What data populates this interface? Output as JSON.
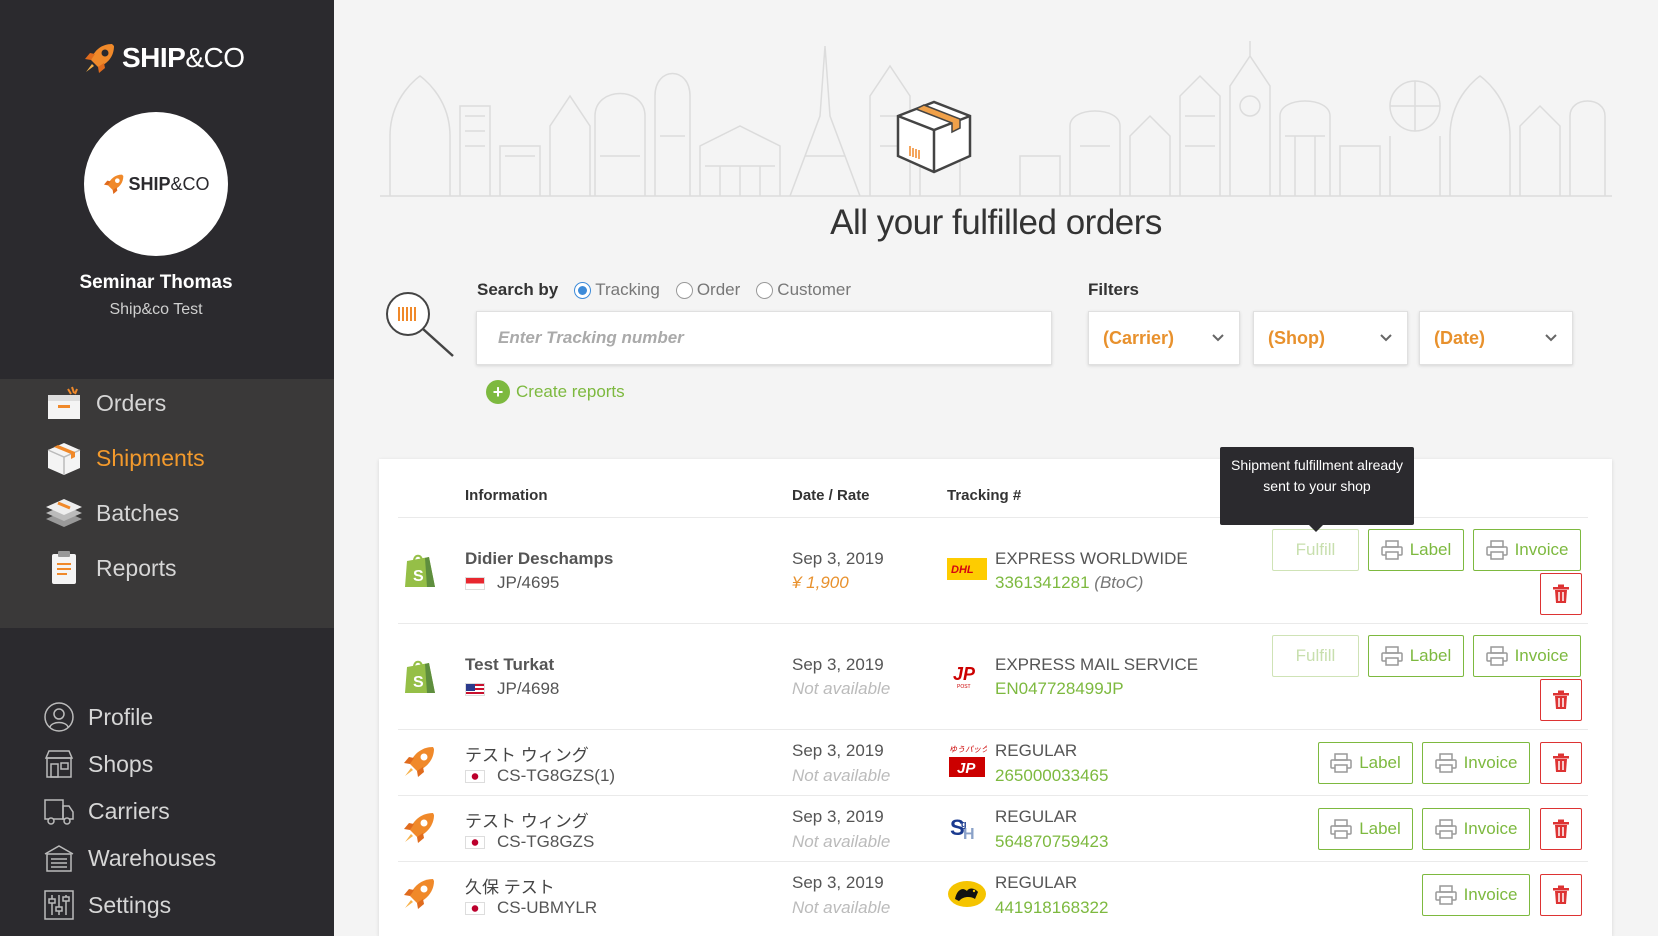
{
  "brand": {
    "name_bold": "SHIP",
    "name_light": "&CO"
  },
  "user": {
    "name": "Seminar Thomas",
    "org": "Ship&co Test"
  },
  "nav_main": [
    {
      "label": "Orders",
      "icon": "orders-box-icon",
      "active": false
    },
    {
      "label": "Shipments",
      "icon": "shipment-box-icon",
      "active": true
    },
    {
      "label": "Batches",
      "icon": "batches-stack-icon",
      "active": false
    },
    {
      "label": "Reports",
      "icon": "clipboard-icon",
      "active": false
    }
  ],
  "nav_sub": [
    {
      "label": "Profile",
      "icon": "user-icon"
    },
    {
      "label": "Shops",
      "icon": "shop-icon"
    },
    {
      "label": "Carriers",
      "icon": "truck-icon"
    },
    {
      "label": "Warehouses",
      "icon": "warehouse-icon"
    },
    {
      "label": "Settings",
      "icon": "sliders-icon"
    }
  ],
  "hero": {
    "title": "All your fulfilled orders"
  },
  "search": {
    "label": "Search by",
    "options": [
      "Tracking",
      "Order",
      "Customer"
    ],
    "selected": "Tracking",
    "placeholder": "Enter Tracking number",
    "value": ""
  },
  "create_reports": "Create reports",
  "filters": {
    "label": "Filters",
    "items": [
      "(Carrier)",
      "(Shop)",
      "(Date)"
    ]
  },
  "table": {
    "headers": [
      "Information",
      "Date / Rate",
      "Tracking #"
    ],
    "tooltip": "Shipment fulfillment already sent to your shop",
    "buttons": {
      "fulfill": "Fulfill",
      "label": "Label",
      "invoice": "Invoice"
    },
    "rows": [
      {
        "source": "shopify",
        "name": "Didier Deschamps",
        "flag": "SG",
        "order": "JP/4695",
        "date": "Sep 3, 2019",
        "rate": "¥ 1,900",
        "rate_available": true,
        "carrier": "DHL",
        "service": "EXPRESS WORLDWIDE",
        "tracking": "3361341281",
        "tracking_extra": "(BtoC)",
        "actions": [
          "fulfill",
          "label",
          "invoice",
          "delete"
        ]
      },
      {
        "source": "shopify",
        "name": "Test Turkat",
        "flag": "US",
        "order": "JP/4698",
        "date": "Sep 3, 2019",
        "rate": "Not available",
        "rate_available": false,
        "carrier": "JP Post",
        "service": "EXPRESS MAIL SERVICE",
        "tracking": "EN047728499JP",
        "tracking_extra": "",
        "actions": [
          "fulfill",
          "label",
          "invoice",
          "delete"
        ]
      },
      {
        "source": "shipandco",
        "name": "テスト ウィング",
        "flag": "JP",
        "order": "CS-TG8GZS(1)",
        "date": "Sep 3, 2019",
        "rate": "Not available",
        "rate_available": false,
        "carrier": "Yu-Pack",
        "service": "REGULAR",
        "tracking": "265000033465",
        "tracking_extra": "",
        "actions": [
          "label",
          "invoice",
          "delete"
        ]
      },
      {
        "source": "shipandco",
        "name": "テスト ウィング",
        "flag": "JP",
        "order": "CS-TG8GZS",
        "date": "Sep 3, 2019",
        "rate": "Not available",
        "rate_available": false,
        "carrier": "Sagawa",
        "service": "REGULAR",
        "tracking": "564870759423",
        "tracking_extra": "",
        "actions": [
          "label",
          "invoice",
          "delete"
        ]
      },
      {
        "source": "shipandco",
        "name": "久保 テスト",
        "flag": "JP",
        "order": "CS-UBMYLR",
        "date": "Sep 3, 2019",
        "rate": "Not available",
        "rate_available": false,
        "carrier": "Yamato",
        "service": "REGULAR",
        "tracking": "441918168322",
        "tracking_extra": "",
        "actions": [
          "invoice",
          "delete"
        ]
      }
    ]
  },
  "colors": {
    "sidebar": "#2b2a2e",
    "accent_orange": "#f39a2c",
    "green": "#7db93f",
    "red": "#d33333",
    "blue": "#3d8bd9"
  }
}
